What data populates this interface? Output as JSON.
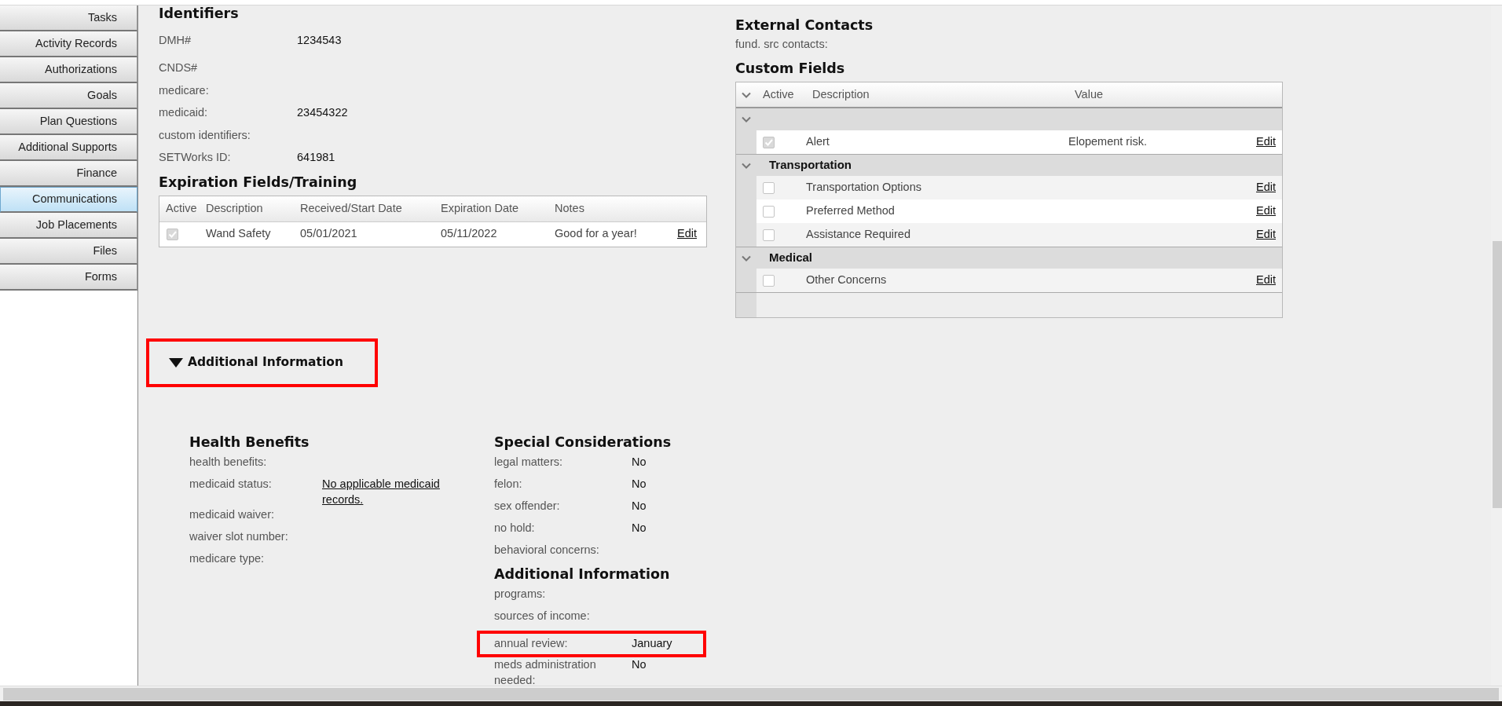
{
  "sidebar": {
    "items": [
      {
        "label": "Tasks",
        "selected": false
      },
      {
        "label": "Activity Records",
        "selected": false
      },
      {
        "label": "Authorizations",
        "selected": false
      },
      {
        "label": "Goals",
        "selected": false
      },
      {
        "label": "Plan Questions",
        "selected": false
      },
      {
        "label": "Additional Supports",
        "selected": false
      },
      {
        "label": "Finance",
        "selected": false
      },
      {
        "label": "Communications",
        "selected": true
      },
      {
        "label": "Job Placements",
        "selected": false
      },
      {
        "label": "Files",
        "selected": false
      },
      {
        "label": "Forms",
        "selected": false
      }
    ]
  },
  "identifiers": {
    "title": "Identifiers",
    "fields": [
      {
        "label": "DMH#",
        "value": "1234543"
      },
      {
        "label": "CNDS#"
      },
      {
        "label": "medicare:"
      },
      {
        "label": "medicaid:",
        "value": "23454322"
      },
      {
        "label": "custom identifiers:"
      },
      {
        "label": "SETWorks ID:",
        "value": "641981"
      }
    ]
  },
  "expiration": {
    "title": "Expiration Fields/Training",
    "columns": [
      "Active",
      "Description",
      "Received/Start Date",
      "Expiration Date",
      "Notes"
    ],
    "rows": [
      {
        "active": true,
        "description": "Wand Safety",
        "received": "05/01/2021",
        "expiration": "05/11/2022",
        "notes": "Good for a year!",
        "action": "Edit"
      }
    ]
  },
  "external_contacts": {
    "title": "External Contacts",
    "fields": [
      {
        "label": "fund. src contacts:"
      }
    ]
  },
  "custom_fields": {
    "title": "Custom Fields",
    "columns": [
      "Active",
      "Description",
      "Value"
    ],
    "groups": [
      {
        "expanded": true,
        "rows": [
          {
            "active": true,
            "description": "Alert",
            "value": "Elopement risk.",
            "action": "Edit"
          }
        ]
      },
      {
        "title": "Transportation",
        "expanded": true,
        "rows": [
          {
            "active": false,
            "description": "Transportation Options",
            "action": "Edit"
          },
          {
            "active": false,
            "description": "Preferred Method",
            "action": "Edit"
          },
          {
            "active": false,
            "description": "Assistance Required",
            "action": "Edit"
          }
        ]
      },
      {
        "title": "Medical",
        "expanded": true,
        "rows": [
          {
            "active": false,
            "description": "Other Concerns",
            "action": "Edit"
          }
        ]
      }
    ]
  },
  "additional_toggle": {
    "label": "Additional Information",
    "expanded": true,
    "annotated": true
  },
  "health_benefits": {
    "title": "Health Benefits",
    "fields": [
      {
        "label": "health benefits:"
      },
      {
        "label": "medicaid status:",
        "value": "No applicable medicaid records.",
        "kind": "link"
      },
      {
        "label": "medicaid waiver:"
      },
      {
        "label": "waiver slot number:"
      },
      {
        "label": "medicare type:"
      }
    ]
  },
  "special_considerations": {
    "title": "Special Considerations",
    "fields": [
      {
        "label": "legal matters:",
        "value": "No"
      },
      {
        "label": "felon:",
        "value": "No"
      },
      {
        "label": "sex offender:",
        "value": "No"
      },
      {
        "label": "no hold:",
        "value": "No"
      },
      {
        "label": "behavioral concerns:"
      }
    ]
  },
  "additional_information": {
    "title": "Additional Information",
    "fields": [
      {
        "label": "programs:",
        "annotated": false
      },
      {
        "label": "sources of income:",
        "annotated": false
      },
      {
        "label": "annual review:",
        "value": "January",
        "annotated": true
      },
      {
        "label": "meds administration needed:",
        "value": "No",
        "annotated": false
      }
    ]
  }
}
